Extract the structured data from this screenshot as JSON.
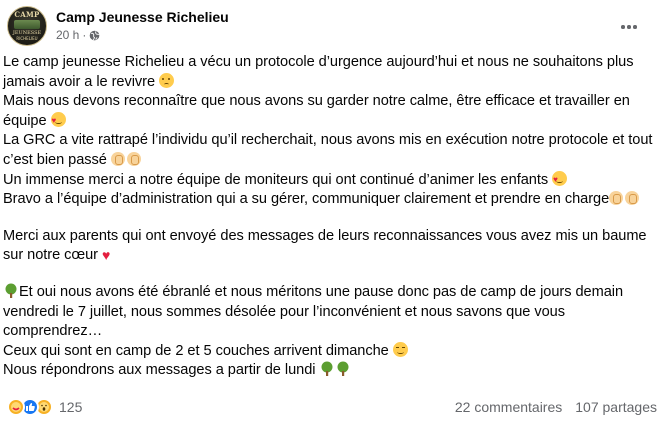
{
  "post": {
    "page_name": "Camp Jeunesse Richelieu",
    "time": "20 h",
    "dot": "·",
    "avatar": {
      "top_text": "CAMP",
      "bottom_text": "JEUNESSE",
      "bottom_text2": "RICHELIEU"
    },
    "icons": {
      "audience": "globe-icon",
      "more": "more-options-icon"
    },
    "paragraph1": {
      "l1": "Le camp jeunesse Richelieu a vécu un protocole d’urgence aujourd’hui et nous ne souhaitons plus jamais avoir a le revivre",
      "l2": "Mais nous devons reconnaître que nous avons su garder notre calme, être efficace et travailler en équipe",
      "l3": "La GRC a vite rattrapé l’individu qu’il recherchait, nous avons mis en exécution notre protocole et tout c’est bien passé",
      "l4": "Un immense merci a notre équipe de moniteurs qui ont continué d’animer les enfants",
      "l5": "Bravo a l’équipe d’administration qui a su gérer, communiquer clairement et prendre en charge"
    },
    "paragraph2": {
      "l1": "Merci aux parents qui ont envoyé des messages de leurs reconnaissances vous avez mis un baume sur notre cœur"
    },
    "paragraph3": {
      "l1": "Et oui nous avons été ébranlé et nous méritons une pause donc pas de camp de jours demain vendredi le 7 juillet, nous sommes désolée pour l’inconvénient et nous savons que vous comprendrez…",
      "l2": "Ceux qui sont en camp de 2 et 5 couches arrivent dimanche",
      "l3": "Nous répondrons aux messages a partir de lundi"
    },
    "emojis": {
      "heart": "♥"
    }
  },
  "footer": {
    "reaction_count": "125",
    "comments": "22 commentaires",
    "shares": "107 partages",
    "reaction_icons": [
      "care-reaction-icon",
      "like-reaction-icon",
      "wow-reaction-icon"
    ]
  },
  "colors": {
    "text": "#050505",
    "secondary": "#65676b",
    "like_blue": "#1877f2",
    "heart_red": "#e41e3f"
  }
}
